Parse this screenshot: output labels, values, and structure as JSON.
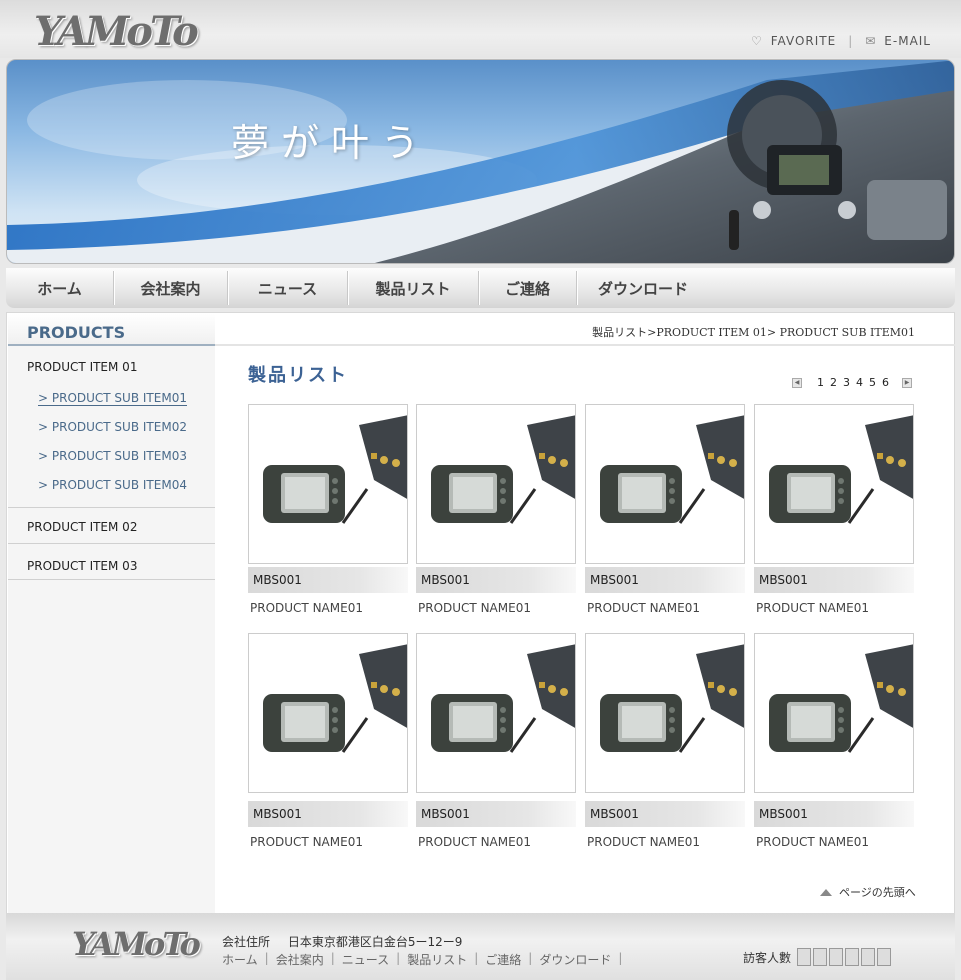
{
  "header": {
    "logo": "YAMoTo",
    "favorite_label": "FAVORITE",
    "email_label": "E-MAIL",
    "favorite_icon": "heart-icon",
    "email_icon": "envelope-icon"
  },
  "banner": {
    "title": "夢が叶う"
  },
  "nav": {
    "items": [
      "ホーム",
      "会社案内",
      "ニュース",
      "製品リスト",
      "ご連絡",
      "ダウンロード"
    ]
  },
  "sidebar": {
    "heading": "PRODUCTS",
    "items": [
      {
        "label": "PRODUCT ITEM 01",
        "subitems": [
          "> PRODUCT SUB ITEM01",
          "> PRODUCT SUB ITEM02",
          "> PRODUCT SUB ITEM03",
          "> PRODUCT SUB ITEM04"
        ]
      },
      {
        "label": "PRODUCT ITEM 02"
      },
      {
        "label": "PRODUCT ITEM 03"
      }
    ]
  },
  "breadcrumb": "製品リスト>PRODUCT ITEM 01> PRODUCT SUB ITEM01",
  "main": {
    "title": "製品リスト",
    "pages": [
      "1",
      "2",
      "3",
      "4",
      "5",
      "6"
    ],
    "products": [
      {
        "code": "MBS001",
        "name": "PRODUCT NAME01"
      },
      {
        "code": "MBS001",
        "name": "PRODUCT NAME01"
      },
      {
        "code": "MBS001",
        "name": "PRODUCT NAME01"
      },
      {
        "code": "MBS001",
        "name": "PRODUCT NAME01"
      },
      {
        "code": "MBS001",
        "name": "PRODUCT NAME01"
      },
      {
        "code": "MBS001",
        "name": "PRODUCT NAME01"
      },
      {
        "code": "MBS001",
        "name": "PRODUCT NAME01"
      },
      {
        "code": "MBS001",
        "name": "PRODUCT NAME01"
      }
    ],
    "to_top": "ページの先頭へ"
  },
  "footer": {
    "logo": "YAMoTo",
    "address_label": "会社住所",
    "address": "日本東京都港区白金台5ー12ー9",
    "links": [
      "ホーム",
      "会社案内",
      "ニュース",
      "製品リスト",
      "ご連絡",
      "ダウンロード"
    ],
    "visitor_label": "訪客人數"
  }
}
